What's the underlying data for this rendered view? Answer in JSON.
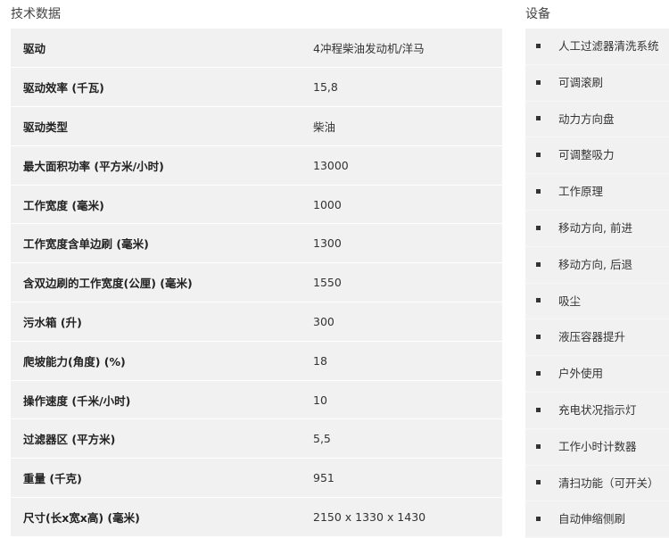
{
  "specs": {
    "title": "技术数据",
    "rows": [
      {
        "label": "驱动",
        "value": "4冲程柴油发动机/洋马"
      },
      {
        "label": "驱动效率 (千瓦)",
        "value": "15,8"
      },
      {
        "label": "驱动类型",
        "value": "柴油"
      },
      {
        "label": "最大面积功率 (平方米/小时)",
        "value": "13000"
      },
      {
        "label": "工作宽度 (毫米)",
        "value": "1000"
      },
      {
        "label": "工作宽度含单边刷 (毫米)",
        "value": "1300"
      },
      {
        "label": "含双边刷的工作宽度(公厘) (毫米)",
        "value": "1550"
      },
      {
        "label": "污水箱 (升)",
        "value": "300"
      },
      {
        "label": "爬坡能力(角度) (%)",
        "value": "18"
      },
      {
        "label": "操作速度 (千米/小时)",
        "value": "10"
      },
      {
        "label": "过滤器区 (平方米)",
        "value": "5,5"
      },
      {
        "label": "重量 (千克)",
        "value": "951"
      },
      {
        "label": "尺寸(长x宽x高) (毫米)",
        "value": "2150 x 1330 x 1430"
      }
    ]
  },
  "equipment": {
    "title": "设备",
    "items": [
      "人工过滤器清洗系统",
      "可调滚刷",
      "动力方向盘",
      "可调整吸力",
      "工作原理",
      "移动方向, 前进",
      "移动方向, 后退",
      "吸尘",
      "液压容器提升",
      "户外使用",
      "充电状况指示灯",
      "工作小时计数器",
      "清扫功能（可开关）",
      "自动伸缩侧刷"
    ]
  }
}
